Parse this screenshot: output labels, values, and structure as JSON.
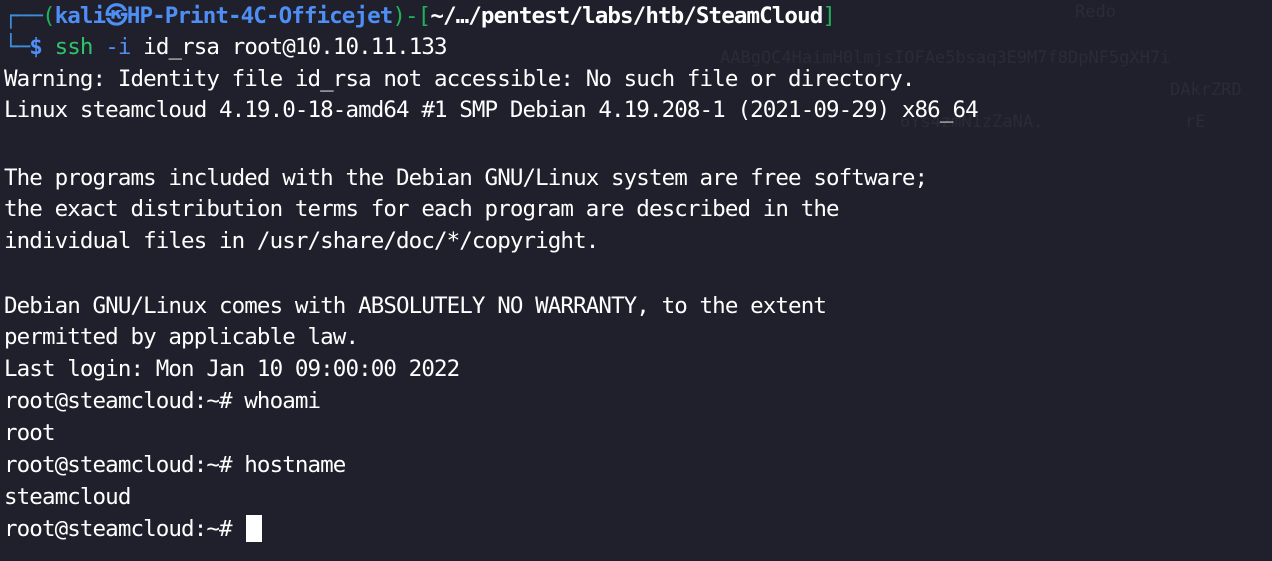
{
  "prompt": {
    "corner_top": "┌──",
    "corner_bottom": "└─",
    "open_paren": "(",
    "user": "kali",
    "at_symbol": "㉿",
    "host": "HP-Print-4C-Officejet",
    "close_paren_dash": ")-[",
    "path": "~/…/pentest/labs/htb/SteamCloud",
    "close_bracket": "]",
    "dollar": "$",
    "command": "ssh",
    "flag": "-i",
    "args": "id_rsa root@10.10.11.133"
  },
  "output": {
    "line1": "Warning: Identity file id_rsa not accessible: No such file or directory.",
    "line2": "Linux steamcloud 4.19.0-18-amd64 #1 SMP Debian 4.19.208-1 (2021-09-29) x86_64",
    "line3": "The programs included with the Debian GNU/Linux system are free software;",
    "line4": "the exact distribution terms for each program are described in the",
    "line5": "individual files in /usr/share/doc/*/copyright.",
    "line6": "Debian GNU/Linux comes with ABSOLUTELY NO WARRANTY, to the extent",
    "line7": "permitted by applicable law.",
    "line8": "Last login: Mon Jan 10 09:00:00 2022",
    "line9": "root@steamcloud:~# whoami",
    "line10": "root",
    "line11": "root@steamcloud:~# hostname",
    "line12": "steamcloud",
    "line13": "root@steamcloud:~# "
  },
  "ghost_text": {
    "g1": "Redo",
    "g2": "AABgQC4HaimH0lmjsIOFAe5bsaq3E9M7f8DpNF5gXH7i",
    "g3": "DAkrZRD",
    "g4": "6Ys4zmN1zZaNA.",
    "g5": "rE"
  }
}
